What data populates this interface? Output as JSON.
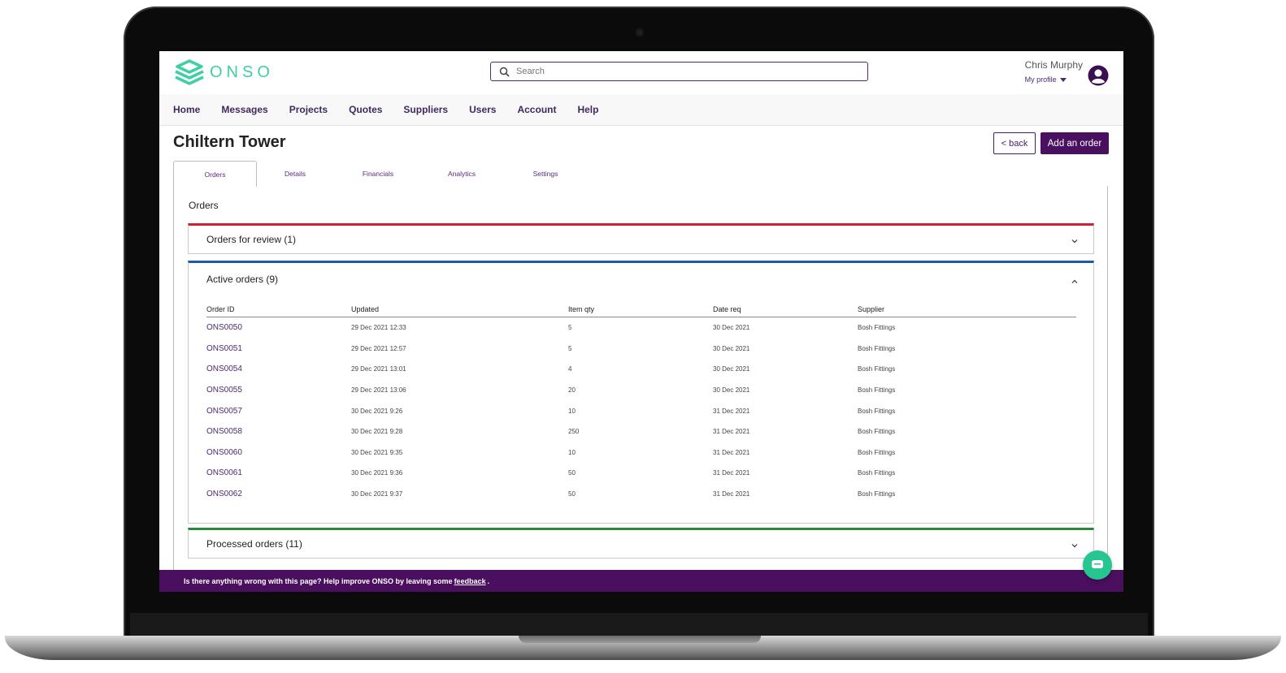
{
  "app": {
    "logo_text": "ONSO",
    "search_placeholder": "Search",
    "user_name": "Chris Murphy",
    "profile_label": "My profile",
    "colors": {
      "brand_purple": "#4a1060",
      "logo_green": "#3ecfa5",
      "review": "#d11f2f",
      "active": "#1a5aa8",
      "processed": "#2a8a3c"
    }
  },
  "nav": [
    "Home",
    "Messages",
    "Projects",
    "Quotes",
    "Suppliers",
    "Users",
    "Account",
    "Help"
  ],
  "page": {
    "title": "Chiltern Tower",
    "back_label": "< back",
    "add_label": "Add an order"
  },
  "tabs": [
    "Orders",
    "Details",
    "Financials",
    "Analytics",
    "Settings"
  ],
  "orders_heading": "Orders",
  "sections": {
    "review": "Orders for review (1)",
    "active": "Active orders (9)",
    "processed": "Processed orders (11)"
  },
  "table": {
    "headers": [
      "Order ID",
      "Updated",
      "Item qty",
      "Date req",
      "Supplier"
    ],
    "rows": [
      [
        "ONS0050",
        "29 Dec 2021 12:33",
        "5",
        "30 Dec 2021",
        "Bosh Fittings"
      ],
      [
        "ONS0051",
        "29 Dec 2021 12:57",
        "5",
        "30 Dec 2021",
        "Bosh Fittings"
      ],
      [
        "ONS0054",
        "29 Dec 2021 13:01",
        "4",
        "30 Dec 2021",
        "Bosh Fittings"
      ],
      [
        "ONS0055",
        "29 Dec 2021 13:06",
        "20",
        "30 Dec 2021",
        "Bosh Fittings"
      ],
      [
        "ONS0057",
        "30 Dec 2021 9:26",
        "10",
        "31 Dec 2021",
        "Bosh Fittings"
      ],
      [
        "ONS0058",
        "30 Dec 2021 9:28",
        "250",
        "31 Dec 2021",
        "Bosh Fittings"
      ],
      [
        "ONS0060",
        "30 Dec 2021 9:35",
        "10",
        "31 Dec 2021",
        "Bosh Fittings"
      ],
      [
        "ONS0061",
        "30 Dec 2021 9:36",
        "50",
        "31 Dec 2021",
        "Bosh Fittings"
      ],
      [
        "ONS0062",
        "30 Dec 2021 9:37",
        "50",
        "31 Dec 2021",
        "Bosh Fittings"
      ]
    ]
  },
  "feedback": {
    "prefix": "Is there anything wrong with this page? Help improve ONSO by leaving some",
    "link": "feedback",
    "suffix": "."
  }
}
